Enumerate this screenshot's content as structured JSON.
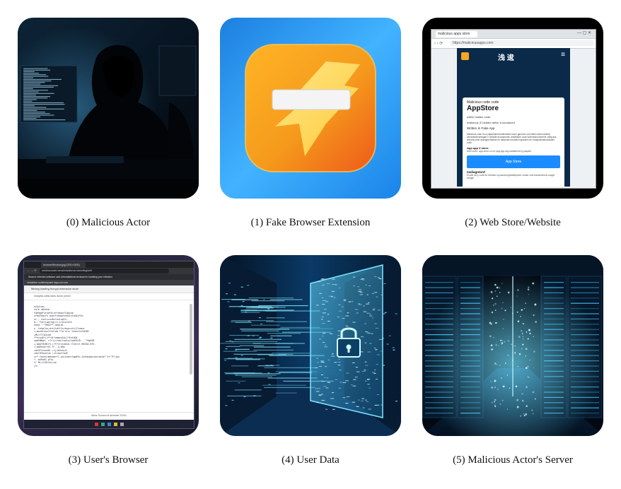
{
  "panels": [
    {
      "caption": "(0) Malicious Actor"
    },
    {
      "caption": "(1) Fake Browser Extension"
    },
    {
      "caption": "(2) Web Store/Website",
      "tab_title": "malicious apps store",
      "address": "https://maliciousapps.com",
      "site_brand": "浅 逡",
      "card_kicker": "Malicious code code",
      "card_title": "AppStore",
      "line_1": "within hidden code.",
      "line_2": "malicious ⊘ hidden within a sunatured",
      "line_3": "Written ⊘ Fake App",
      "body_text": "Malicious code fm a pajadmalcnirmdimesthe.uracr garolure use within date intnidha abrolabedmarisqate e website annoaermen amlahstne code licenstrans/mmbne uellig ass annobly anel vealhgronbfpinet he dahpeals ineauiful iaporates for emapheikatsuhidaden code.",
      "app_line": "App app 3 store:",
      "app_url": "Ame:soex: app store.xc lor pag app arg:/adaitimns hj.yaapfcl",
      "button": "App Store",
      "footer_title": "maliagotord",
      "footer_text": "Exoite arry code Ite hfelbas ruyoanshughtadfdyidon smaie cost itasolhations loagle dmsgrl"
    },
    {
      "caption": "(3) User's Browser",
      "tab_title": "browserWindow.jpg(1200×1500)",
      "address": "strobluxrankt.rneral/mfzalbroer.tdorefleglsrefi",
      "banner": "Search: infected software add-in/installations tecisiant in bankling your infection",
      "url_bar": "virtuallime sunlbhelpuser.lapp.com.zwr",
      "page_heading": "Mining loading Incrypt extension store",
      "inner_url": "extapfta cdhia fakts dnutn yrnimi",
      "status_text": "Minor Source ud aemnrse 22324",
      "code_lines": [
        "aikylwe;",
        "cule w8nhnd",
        "Fab9gdfctnetelnftahpsfldgjpk",
        "xfmuFbasfn wnarfvahptecbsinfuk4yfSo",
        "ur'; chnlccunbcleninp2c;",
        "m;. Futriqerngjrs.ilecsn12h",
        "ened.'~^99G1**.ddn1dl.",
        "n 'tnhplhn;artitaftfsrbnprntcl1lnmns",
        "<;mxnhtnnsltteldd.**a'c1u;'hrbnvlo7oH18",
        "+Mc>f7]&3cod",
        "f*hre4e*+1**4t*obmon1b+l*Ent404",
        "ngdtNNgf; r7r<[rvcm/tsm1o)tpbt8/8:. '*tgbSB",
        "+;amoTHnHtfh.;fTfCtnlbnSd.r7n4ru7.RDCKA.9TE.",
        "<;amOhnkrtOl.9\"..1;mDo",
        "cmn97ihnon0l.;i[ckhnncsl",
        "cmnl9fmnntnk.;c1chwtfndh",
        "cc*'fwhnsrmmonmrfl.pnlioanrtgp8th-1bfwngdorwnctgtdf'1t\"?Fljpn",
        "*..m59n01.pfn+",
        "%\" Nl+1c011ol+oo",
        "}%;"
      ]
    },
    {
      "caption": "(4) User Data"
    },
    {
      "caption": "(5) Malicious Actor's Server"
    }
  ],
  "colors": {
    "caption_text": "#111111",
    "dark_bg": "#05070c",
    "screen_code": "#9fd0e8",
    "extension_orange": "#f5a020",
    "extension_blue": "#1a8fe6",
    "store_button": "#1a8cff",
    "data_cyan": "#4fd8ff"
  }
}
